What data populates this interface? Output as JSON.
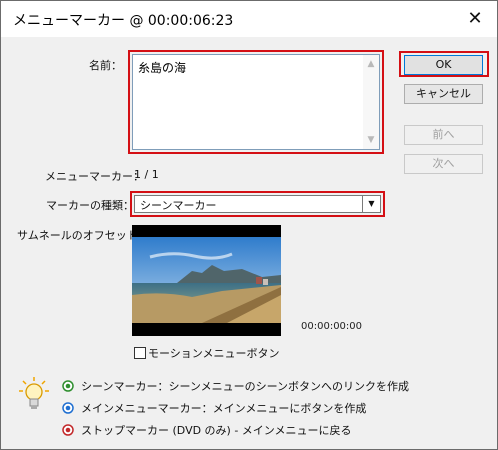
{
  "window": {
    "title": "メニューマーカー @ 00:00:06:23",
    "close_glyph": "✕"
  },
  "form": {
    "name_label": "名前：",
    "name_value": "糸島の海",
    "menu_marker_label": "メニューマーカー：",
    "menu_marker_value": "1 / 1",
    "marker_type_label": "マーカーの種類：",
    "marker_type_value": "シーンマーカー",
    "thumbnail_offset_label": "サムネールのオフセット：",
    "thumbnail_timecode": "00:00:00:00",
    "motion_button_label": "モーションメニューボタン",
    "motion_button_checked": false
  },
  "buttons": {
    "ok": "OK",
    "cancel": "キャンセル",
    "prev": "前へ",
    "next": "次へ"
  },
  "legend": [
    {
      "icon": "scene-marker-icon",
      "color": "#2f8f2f",
      "text": "シーンマーカー：シーンメニューのシーンボタンへのリンクを作成"
    },
    {
      "icon": "main-menu-marker-icon",
      "color": "#1f6fd1",
      "text": "メインメニューマーカー：メインメニューにボタンを作成"
    },
    {
      "icon": "stop-marker-icon",
      "color": "#c2282a",
      "text": "ストップマーカー (DVD のみ) - メインメニューに戻る"
    }
  ],
  "colors": {
    "highlight": "#d40f14",
    "dialog_bg": "#f0f0f0"
  }
}
